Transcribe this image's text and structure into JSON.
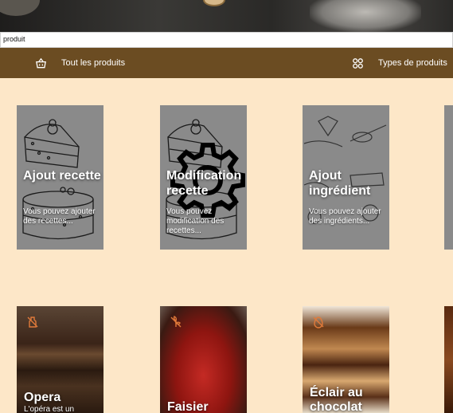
{
  "search": {
    "value": "produit"
  },
  "nav": {
    "all_products": "Tout les produits",
    "product_types": "Types de produits"
  },
  "actions": [
    {
      "title": "Ajout recette",
      "desc": "Vous pouvez ajouter des recettes..."
    },
    {
      "title": "Modification recette",
      "desc": "Vous pouvez modification des recettes..."
    },
    {
      "title": "Ajout ingrédient",
      "desc": "Vous pouvez ajouter des ingrédients..."
    }
  ],
  "products": [
    {
      "title": "Opera",
      "desc": "L'opéra est un",
      "badge": "no-milk-icon"
    },
    {
      "title": "Faisier",
      "desc": "",
      "badge": "no-gluten-icon"
    },
    {
      "title": "Éclair au chocolat",
      "desc": "",
      "badge": "no-egg-icon"
    }
  ],
  "colors": {
    "navbar": "#6b4c22",
    "page_bg": "#fde7c8",
    "badge": "#e07a3a"
  }
}
